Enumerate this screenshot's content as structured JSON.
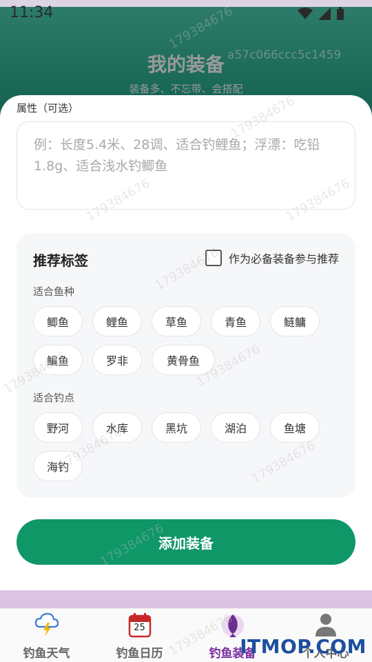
{
  "status_bar": {
    "time": "11:34"
  },
  "header": {
    "title": "我的装备",
    "subtitle": "装备多、不忘带、会搭配"
  },
  "attributes": {
    "label": "属性（可选）",
    "placeholder": "例：长度5.4米、28调、适合钓鲤鱼；浮漂：吃铅1.8g、适合浅水钓鲫鱼"
  },
  "recommend": {
    "title": "推荐标签",
    "must_have_label": "作为必备装备参与推荐",
    "fish_group_label": "适合鱼种",
    "fish": [
      "鲫鱼",
      "鲤鱼",
      "草鱼",
      "青鱼",
      "鲢鳙",
      "鳊鱼",
      "罗非",
      "黄骨鱼"
    ],
    "spot_group_label": "适合钓点",
    "spots": [
      "野河",
      "水库",
      "黑坑",
      "湖泊",
      "鱼塘",
      "海钓"
    ]
  },
  "add_button": "添加装备",
  "tabs": [
    {
      "label": "钓鱼天气",
      "icon": "weather-icon",
      "active": false
    },
    {
      "label": "钓鱼日历",
      "icon": "calendar-icon",
      "active": false,
      "badge": "25"
    },
    {
      "label": "钓鱼装备",
      "icon": "fish-gear-icon",
      "active": true
    },
    {
      "label": "个人中心",
      "icon": "person-icon",
      "active": false
    }
  ],
  "colors": {
    "accent": "#0f9767",
    "active_tab": "#7b2fa0",
    "header": "#1c6b5a"
  },
  "watermarks": [
    "a57c066ccc5c1459",
    "179384676"
  ],
  "corner_logo": "ITMOP.COM"
}
